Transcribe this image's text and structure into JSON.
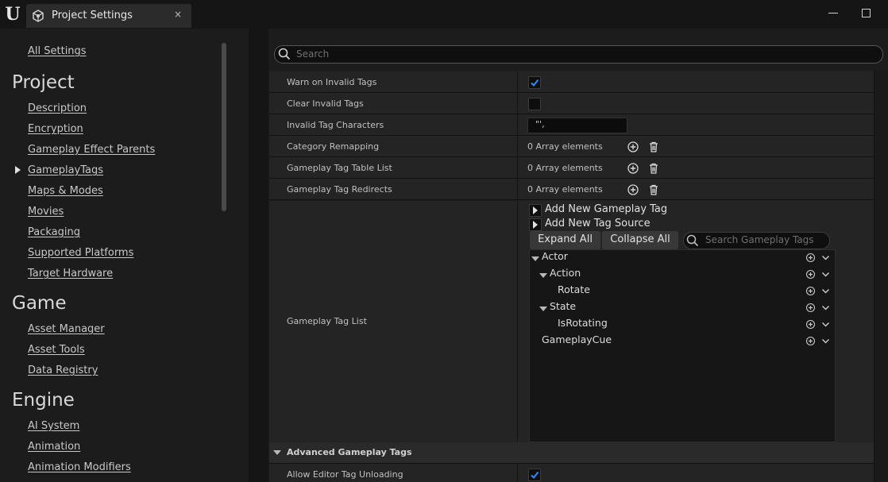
{
  "window": {
    "tab_title": "Project Settings",
    "close_glyph": "×"
  },
  "sidebar": {
    "all_settings": "All Settings",
    "sections": [
      {
        "title": "Project",
        "items": [
          "Description",
          "Encryption",
          "Gameplay Effect Parents",
          "GameplayTags",
          "Maps & Modes",
          "Movies",
          "Packaging",
          "Supported Platforms",
          "Target Hardware"
        ]
      },
      {
        "title": "Game",
        "items": [
          "Asset Manager",
          "Asset Tools",
          "Data Registry"
        ]
      },
      {
        "title": "Engine",
        "items": [
          "AI System",
          "Animation",
          "Animation Modifiers"
        ]
      }
    ],
    "selected_item": "GameplayTags"
  },
  "search": {
    "placeholder": "Search"
  },
  "properties": [
    {
      "label": "Warn on Invalid Tags",
      "type": "checkbox",
      "checked": true
    },
    {
      "label": "Clear Invalid Tags",
      "type": "checkbox",
      "checked": false
    },
    {
      "label": "Invalid Tag Characters",
      "type": "text",
      "value": "\"',"
    },
    {
      "label": "Category Remapping",
      "type": "array",
      "value": "0 Array elements"
    },
    {
      "label": "Gameplay Tag Table List",
      "type": "array",
      "value": "0 Array elements"
    },
    {
      "label": "Gameplay Tag Redirects",
      "type": "array",
      "value": "0 Array elements"
    }
  ],
  "tag_list": {
    "label": "Gameplay Tag List",
    "add_tag": "Add New Gameplay Tag",
    "add_source": "Add New Tag Source",
    "expand_all": "Expand All",
    "collapse_all": "Collapse All",
    "search_placeholder": "Search Gameplay Tags",
    "tags": [
      {
        "name": "Actor",
        "depth": 0,
        "expanded": true
      },
      {
        "name": "Action",
        "depth": 1,
        "expanded": true
      },
      {
        "name": "Rotate",
        "depth": 2
      },
      {
        "name": "State",
        "depth": 1,
        "expanded": true
      },
      {
        "name": "IsRotating",
        "depth": 2
      },
      {
        "name": "GameplayCue",
        "depth": 0
      }
    ]
  },
  "advanced": {
    "header": "Advanced Gameplay Tags",
    "items": [
      {
        "label": "Allow Editor Tag Unloading",
        "type": "checkbox",
        "checked": true
      }
    ]
  },
  "colors": {
    "check_accent": "#2a8cff",
    "panel": "#242424",
    "background": "#151515"
  }
}
